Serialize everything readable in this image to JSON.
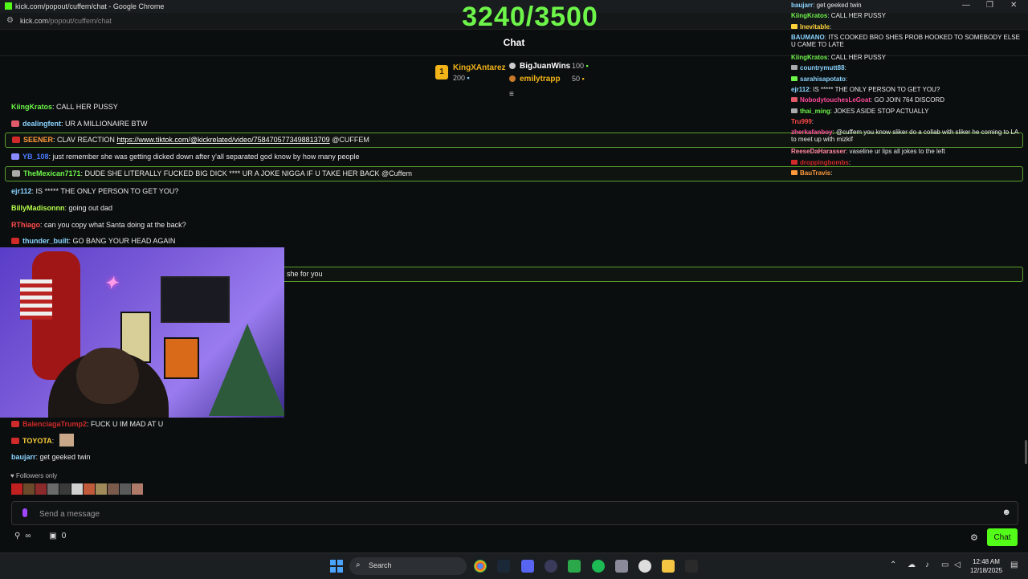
{
  "window": {
    "title": "kick.com/popout/cuffem/chat - Google Chrome",
    "url_host": "kick.com",
    "url_path": "/popout/cuffem/chat",
    "minimize": "—",
    "maximize": "❐",
    "close": "✕"
  },
  "counter": "3240/3500",
  "chat_title": "Chat",
  "leaderboard": {
    "first": {
      "rank": "1",
      "name": "KingXAntarez",
      "amount": "200"
    },
    "others": [
      {
        "name": "BigJuanWins",
        "amount": "100",
        "color": "#ffffff"
      },
      {
        "name": "emilytrapp",
        "amount": "50",
        "color": "#f2b418"
      }
    ]
  },
  "messages": [
    {
      "user": "KiingKratos",
      "text": ": CALL HER PUSSY",
      "color": "#6ef54a",
      "badge": "",
      "boxed": false
    },
    {
      "user": "dealingfent",
      "text": ": UR A MILLIONAIRE BTW",
      "color": "#8ad4ff",
      "badge": "#e05a6a",
      "boxed": false
    },
    {
      "user": "SEENER",
      "text": ": CLAV REACTION ",
      "link": "https://www.tiktok.com/@kickrelated/video/7584705773498813709",
      "after": " @CUFFEM",
      "color": "#ff9a3c",
      "badge": "#d02a2a",
      "boxed": true
    },
    {
      "user": "YB_108",
      "text": ": just remember she was getting dicked down after y'all separated god know by how many people",
      "color": "#4a7bff",
      "badge": "#8a8aff",
      "boxed": false
    },
    {
      "user": "TheMexican7171",
      "text": ": DUDE SHE LITERALLY FUCKED BIG DICK **** UR A JOKE NIGGA IF U TAKE HER BACK @Cuffem",
      "color": "#6ef54a",
      "badge": "#aaaaaa",
      "boxed": true
    },
    {
      "user": "ejr112",
      "text": ": IS ***** THE ONLY PERSON TO GET YOU?",
      "color": "#8ad4ff",
      "badge": "",
      "boxed": false
    },
    {
      "user": "BillyMadisonnn",
      "text": ": going out dad",
      "color": "#b6ff4a",
      "badge": "",
      "boxed": false
    },
    {
      "user": "RThiago",
      "text": ": can you copy what Santa doing at the back?",
      "color": "#ff4a4a",
      "badge": "",
      "boxed": false
    },
    {
      "user": "thunder_built",
      "text": ": GO BANG YOUR HEAD AGAIN",
      "color": "#8ad4ff",
      "badge": "#d02a2a",
      "boxed": false
    },
    {
      "user": "",
      "text": "she for you",
      "color": "#ffffff",
      "badge": "",
      "boxed": true
    },
    {
      "user": "BalenciagaTrump2",
      "text": ": FUCK U IM MAD AT U",
      "color": "#d02a2a",
      "badge": "#d02a2a",
      "boxed": false
    },
    {
      "user": "TOYOTA",
      "text": ":",
      "color": "#ffd23a",
      "badge": "#d02a2a",
      "boxed": false
    },
    {
      "user": "baujarr",
      "text": ": get geeked twin",
      "color": "#8ad4ff",
      "badge": "",
      "boxed": false
    }
  ],
  "followers_only": "Followers only",
  "input": {
    "placeholder": "Send a message"
  },
  "bottom": {
    "count": "0",
    "chat_button": "Chat"
  },
  "overlay": [
    {
      "user": "baujarr",
      "text": ": get geeked twin",
      "color": "#8ad4ff",
      "badge": ""
    },
    {
      "user": "KiingKratos",
      "text": ": CALL HER PUSSY",
      "color": "#6ef54a",
      "badge": ""
    },
    {
      "user": "Inevitable",
      "text": ":",
      "color": "#ffd23a",
      "badge": "#ffd23a"
    },
    {
      "user": "BAUMANO",
      "text": ": ITS COOKED BRO SHES PROB HOOKED TO SOMEBODY ELSE U CAME TO LATE",
      "color": "#8ad4ff",
      "badge": "",
      "wrap": true
    },
    {
      "user": "KiingKratos",
      "text": ": CALL HER PUSSY",
      "color": "#6ef54a",
      "badge": ""
    },
    {
      "user": "countrymutt88",
      "text": ":",
      "color": "#8ad4ff",
      "badge": "#aaaaaa"
    },
    {
      "user": "sarahisapotato",
      "text": ":",
      "color": "#8ad4ff",
      "badge": "#6ef54a"
    },
    {
      "user": "ejr112",
      "text": ": IS ***** THE ONLY PERSON TO GET YOU?",
      "color": "#8ad4ff",
      "badge": ""
    },
    {
      "user": "NobodytouchesLeGoat",
      "text": ": GO JOIN 764 DISCORD",
      "color": "#ff4a9a",
      "badge": "#e05a6a"
    },
    {
      "user": "thai_ming",
      "text": ": JOKES ASIDE STOP ACTUALLY",
      "color": "#6ef54a",
      "badge": "#aaaaaa"
    },
    {
      "user": "Tru999",
      "text": ":",
      "color": "#ff4a4a",
      "badge": ""
    },
    {
      "user": "zherkafanboy",
      "text": ": @cuffem you know sliker do a collab with sliker he coming to LA to meet up with mizkif",
      "color": "#ff4a9a",
      "badge": "",
      "wrap": true
    },
    {
      "user": "ReeseDaHarasser",
      "text": ": vaseline ur lips all jokes to the left",
      "color": "#ff8aa0",
      "badge": ""
    },
    {
      "user": "droppingbombs",
      "text": ":",
      "color": "#d02a2a",
      "badge": "#d02a2a"
    },
    {
      "user": "BauTravis",
      "text": ":",
      "color": "#ff9a3c",
      "badge": "#ff9a3c"
    }
  ],
  "taskbar": {
    "search_label": "Search",
    "time": "12:48 AM",
    "date": "12/18/2025"
  },
  "colors": {
    "accent": "#53fc18",
    "background": "#0b0e0f"
  }
}
